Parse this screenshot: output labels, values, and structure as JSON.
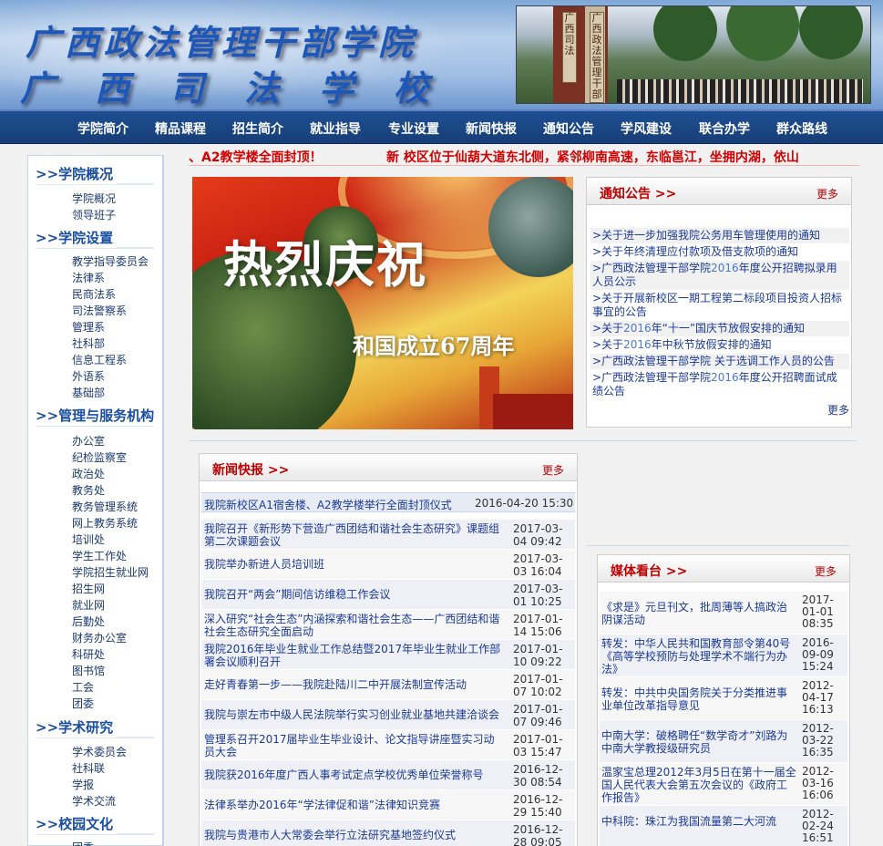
{
  "banner": {
    "title_line1": "广西政法管理干部学院",
    "title_line2": "广西司法学校",
    "sign_left": "广西司法",
    "sign_right": "广西政法管理干部"
  },
  "nav": {
    "items": [
      "学院简介",
      "精品课程",
      "招生简介",
      "就业指导",
      "专业设置",
      "新闻快报",
      "通知公告",
      "学风建设",
      "联合办学",
      "群众路线"
    ]
  },
  "sidebar": {
    "sections": [
      {
        "title": ">>学院概况",
        "links": [
          "学院概况",
          "领导班子"
        ]
      },
      {
        "title": ">>学院设置",
        "links": [
          "教学指导委员会",
          "法律系",
          "民商法系",
          "司法警察系",
          "管理系",
          "社科部",
          "信息工程系",
          "外语系",
          "基础部"
        ]
      },
      {
        "title": ">>管理与服务机构",
        "links": [
          "办公室",
          "纪检监察室",
          "政治处",
          "教务处",
          "教务管理系统",
          "网上教务系统",
          "培训处",
          "学生工作处",
          "学院招生就业网",
          "招生网",
          "就业网",
          "后勤处",
          "财务办公室",
          "科研处",
          "图书馆",
          "工会",
          "团委"
        ]
      },
      {
        "title": ">>学术研究",
        "links": [
          "学术委员会",
          "社科联",
          "学报",
          "学术交流"
        ]
      },
      {
        "title": ">>校园文化",
        "links": [
          "团委"
        ]
      }
    ]
  },
  "marquee": {
    "text1": "、A2教学楼全面封顶！",
    "text2": "新 校区位于仙葫大道东北侧，紧邻柳南高速，东临邕江，坐拥内湖，依山"
  },
  "main_photo": {
    "headline": "热烈庆祝",
    "subline": "和国成立67周年"
  },
  "notice": {
    "title": "通知公告 >>",
    "more": "更多",
    "more_bottom": "更多",
    "items": [
      {
        "pre": ">关于进一步加强我院公务用车管理使用的通知",
        "hl": "",
        "post": ""
      },
      {
        "pre": ">关于年终清理应付款项及借支款项的通知",
        "hl": "",
        "post": ""
      },
      {
        "pre": ">广西政法管理干部学院",
        "hl": "2016",
        "post": "年度公开招聘拟录用人员公示"
      },
      {
        "pre": ">关于开展新校区一期工程第二标段项目投资人招标事宜的公告",
        "hl": "",
        "post": ""
      },
      {
        "pre": ">关于",
        "hl": "2016",
        "post": "年“十一”国庆节放假安排的通知"
      },
      {
        "pre": ">关于",
        "hl": "2016",
        "post": "年中秋节放假安排的通知"
      },
      {
        "pre": ">广西政法管理干部学院 关于选调工作人员的公告",
        "hl": "",
        "post": ""
      },
      {
        "pre": ">广西政法管理干部学院",
        "hl": "2016",
        "post": "年度公开招聘面试成绩公告"
      }
    ]
  },
  "news": {
    "title": "新闻快报 >>",
    "more": "更多",
    "featured": {
      "title": "我院新校区A1宿舍楼、A2教学楼举行全面封顶仪式",
      "date": "2016-04-20 15:30"
    },
    "items": [
      {
        "title": "我院召开《新形势下营造广西团结和谐社会生态研究》课题组第二次课题会议",
        "date": "2017-03-04 09:42"
      },
      {
        "title": "我院举办新进人员培训班",
        "date": "2017-03-03 16:04"
      },
      {
        "title": "我院召开“两会”期间信访维稳工作会议",
        "date": "2017-03-01 10:25"
      },
      {
        "title": "深入研究“社会生态”内涵探索和谐社会生态——广西团结和谐社会生态研究全面启动",
        "date": "2017-01-14 15:06"
      },
      {
        "title": "我院2016年毕业生就业工作总结暨2017年毕业生就业工作部署会议顺利召开",
        "date": "2017-01-10 09:22"
      },
      {
        "title": "走好青春第一步——我院赴陆川二中开展法制宣传活动",
        "date": "2017-01-07 10:02"
      },
      {
        "title": "我院与崇左市中级人民法院举行实习创业就业基地共建洽谈会",
        "date": "2017-01-07 09:46"
      },
      {
        "title": "管理系召开2017届毕业生毕业设计、论文指导讲座暨实习动员大会",
        "date": "2017-01-03 15:47"
      },
      {
        "title": "我院获2016年度广西人事考试定点学校优秀单位荣誉称号",
        "date": "2016-12-30 08:54"
      },
      {
        "title": "法律系举办2016年“学法律促和谐”法律知识竞赛",
        "date": "2016-12-29 15:40"
      },
      {
        "title": "我院与贵港市人大常委会举行立法研究基地签约仪式",
        "date": "2016-12-28 09:05"
      }
    ]
  },
  "media": {
    "title": "媒体看台 >>",
    "more": "更多",
    "items": [
      {
        "title": "《求是》元旦刊文，批周薄等人搞政治阴谋活动",
        "date": "2017-01-01 08:35"
      },
      {
        "title": "转发：中华人民共和国教育部令第40号《高等学校预防与处理学术不端行为办法》",
        "date": "2016-09-09 15:24"
      },
      {
        "title": "转发：中共中央国务院关于分类推进事业单位改革指导意见",
        "date": "2012-04-17 16:13"
      },
      {
        "title": "中南大学：破格聘任“数学奇才”刘路为中南大学教授级研究员",
        "date": "2012-03-22 16:35"
      },
      {
        "title": "温家宝总理2012年3月5日在第十一届全国人民代表大会第五次会议的《政府工作报告》",
        "date": "2012-03-16 16:06"
      },
      {
        "title": "中科院：珠江为我国流量第二大河流",
        "date": "2012-02-24 16:51"
      }
    ]
  },
  "colors": {
    "nav_bg": "#1e4f92",
    "section_title": "#1a4ea0",
    "panel_title": "#c00000",
    "link": "#1a3a99",
    "marquee": "#d40000"
  }
}
